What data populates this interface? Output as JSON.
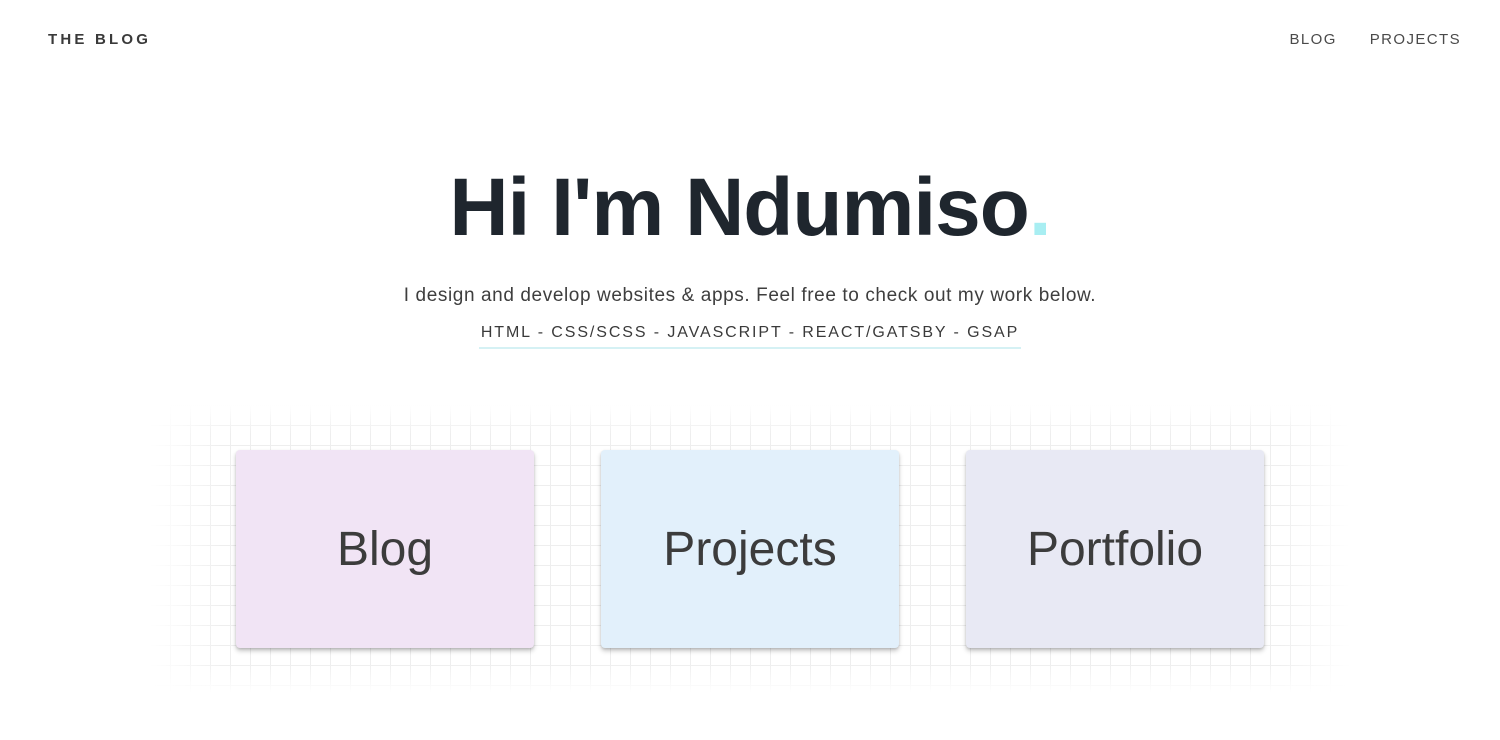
{
  "header": {
    "brand": "THE BLOG",
    "nav": [
      {
        "label": "BLOG"
      },
      {
        "label": "PROJECTS"
      }
    ]
  },
  "hero": {
    "name_line": "Hi I'm Ndumiso",
    "name_dot": ".",
    "dot_color": "#a8eef2",
    "tagline": "I design and develop websites & apps. Feel free to check out my work below.",
    "skills": "HTML - CSS/SCSS - JAVASCRIPT - REACT/GATSBY - GSAP"
  },
  "cards": [
    {
      "label": "Blog",
      "color": "#f1e4f5"
    },
    {
      "label": "Projects",
      "color": "#e2f0fb"
    },
    {
      "label": "Portfolio",
      "color": "#e8e9f4"
    }
  ]
}
